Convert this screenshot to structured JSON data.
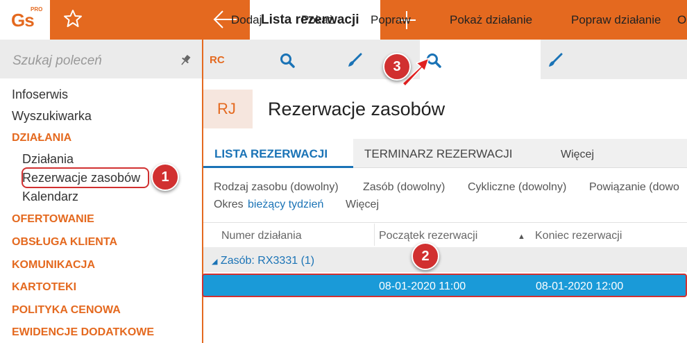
{
  "app": {
    "logo": "Gs",
    "logo_sup": "PRO"
  },
  "header": {
    "active_tab": "Lista rezerwacji"
  },
  "sidebar": {
    "search_placeholder": "Szukaj poleceń",
    "items": [
      {
        "label": "Infoserwis"
      },
      {
        "label": "Wyszukiwarka"
      },
      {
        "label": "DZIAŁANIA"
      },
      {
        "label": "Działania"
      },
      {
        "label": "Rezerwacje zasobów"
      },
      {
        "label": "Kalendarz"
      },
      {
        "label": "OFERTOWANIE"
      },
      {
        "label": "OBSŁUGA KLIENTA"
      },
      {
        "label": "KOMUNIKACJA"
      },
      {
        "label": "KARTOTEKI"
      },
      {
        "label": "POLITYKA CENOWA"
      },
      {
        "label": "EWIDENCJE DODATKOWE"
      }
    ]
  },
  "toolbar": {
    "rc_icon": "RC",
    "add": "Dodaj",
    "show": "Pokaż",
    "edit": "Popraw",
    "show_action": "Pokaż działanie",
    "edit_action": "Popraw działanie",
    "overflow": "O"
  },
  "page": {
    "badge": "RJ",
    "title": "Rezerwacje zasobów"
  },
  "tabs": [
    {
      "label": "LISTA REZERWACJI"
    },
    {
      "label": "TERMINARZ REZERWACJI"
    },
    {
      "label": "Więcej"
    }
  ],
  "filters": {
    "resource_type": "Rodzaj zasobu (dowolny)",
    "resource": "Zasób (dowolny)",
    "cyclic": "Cykliczne (dowolny)",
    "link": "Powiązanie (dowo",
    "period_label": "Okres",
    "period_value": "bieżący tydzień",
    "more": "Więcej"
  },
  "grid": {
    "columns": [
      "Numer działania",
      "Początek rezerwacji",
      "Koniec rezerwacji"
    ],
    "sort_indicator": "▲",
    "group": {
      "label": "Zasób:",
      "value": "RX3331",
      "count": "(1)"
    },
    "rows": [
      {
        "number": "",
        "start": "08-01-2020  11:00",
        "end": "08-01-2020  12:00"
      }
    ]
  },
  "callouts": [
    "1",
    "2",
    "3"
  ],
  "colors": {
    "accent": "#e4691f",
    "link": "#1a73b6",
    "selected_row": "#1a9ad8",
    "callout": "#d13030"
  }
}
